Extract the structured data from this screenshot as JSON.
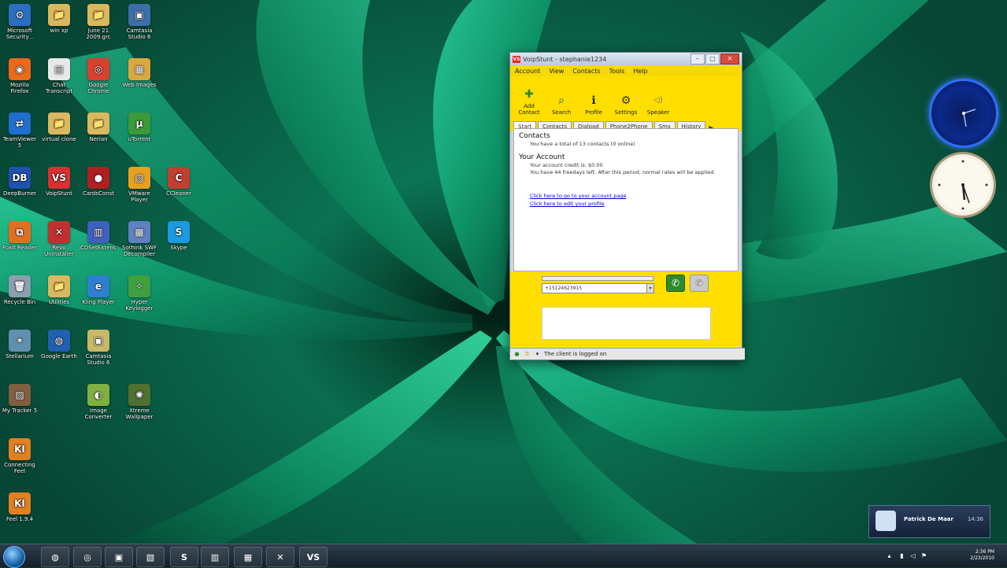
{
  "desktop": {
    "icons": [
      {
        "label": "Microsoft Security...",
        "glyph": "⚙",
        "color": "#2a6fc0"
      },
      {
        "label": "win xp",
        "glyph": "📁",
        "color": "#d9b860"
      },
      {
        "label": "June 21 2009.grc",
        "glyph": "📁",
        "color": "#d9b860"
      },
      {
        "label": "Camtasia Studio 6",
        "glyph": "▣",
        "color": "#3c6fa8"
      },
      {
        "label": "Mozilla Firefox",
        "glyph": "◉",
        "color": "#e86a1a"
      },
      {
        "label": "Chat Transcript",
        "glyph": "▤",
        "color": "#e8e8e8"
      },
      {
        "label": "Google Chrome",
        "glyph": "◎",
        "color": "#d9402e"
      },
      {
        "label": "Web Images",
        "glyph": "▦",
        "color": "#d9a840"
      },
      {
        "label": "TeamViewer 5",
        "glyph": "⇄",
        "color": "#1f6fcf"
      },
      {
        "label": "virtual clone",
        "glyph": "📁",
        "color": "#d9b860"
      },
      {
        "label": "Nerian",
        "glyph": "📁",
        "color": "#d9b860"
      },
      {
        "label": "uTorrent",
        "glyph": "µ",
        "color": "#3c9a3a"
      },
      {
        "label": "DeepBurner",
        "glyph": "DB",
        "color": "#2050b0"
      },
      {
        "label": "VoipStunt",
        "glyph": "VS",
        "color": "#d83030"
      },
      {
        "label": "CardsConst",
        "glyph": "●",
        "color": "#b02020"
      },
      {
        "label": "VMware Player",
        "glyph": "▧",
        "color": "#e8a020"
      },
      {
        "label": "CCleaner",
        "glyph": "C",
        "color": "#c04030"
      },
      {
        "label": "Foxit Reader",
        "glyph": "⧉",
        "color": "#e07020"
      },
      {
        "label": "Revo Uninstaller",
        "glyph": "✕",
        "color": "#c03030"
      },
      {
        "label": "CDSetExtensions",
        "glyph": "▥",
        "color": "#4060c0"
      },
      {
        "label": "Sothink SWF Decompiler",
        "glyph": "▩",
        "color": "#6080c0"
      },
      {
        "label": "Skype",
        "glyph": "S",
        "color": "#1a9ae0"
      },
      {
        "label": "Recycle Bin",
        "glyph": "🗑",
        "color": "#8aa0b0"
      },
      {
        "label": "Utilities",
        "glyph": "📁",
        "color": "#d9b860"
      },
      {
        "label": "Kling Player",
        "glyph": "e",
        "color": "#2f7fd0"
      },
      {
        "label": "Hyper Keylogger",
        "glyph": "✧",
        "color": "#40a040"
      },
      {
        "label": "Stellarium",
        "glyph": "✶",
        "color": "#6090b0"
      },
      {
        "label": "Google Earth",
        "glyph": "◍",
        "color": "#2060b0"
      },
      {
        "label": "Camtasia Studio 6",
        "glyph": "▣",
        "color": "#c8b868"
      },
      {
        "label": "My Tracker 5",
        "glyph": "▨",
        "color": "#806040"
      },
      {
        "label": "Image Converter",
        "glyph": "◐",
        "color": "#80b040"
      },
      {
        "label": "Xtreme Wallpaper",
        "glyph": "✺",
        "color": "#507030"
      },
      {
        "label": "Connecting Feel",
        "glyph": "KI",
        "color": "#e08020"
      },
      {
        "label": "Feel 1.9.4",
        "glyph": "KI",
        "color": "#e08020"
      }
    ]
  },
  "window": {
    "title": "VoipStunt - stephanie1234",
    "app_badge": "VS",
    "menu": [
      "Account",
      "View",
      "Contacts",
      "Tools",
      "Help"
    ],
    "toolbar": [
      {
        "label": "Add Contact",
        "glyph": "✚"
      },
      {
        "label": "Search",
        "glyph": "⌕"
      },
      {
        "label": "Profile",
        "glyph": "ℹ"
      },
      {
        "label": "Settings",
        "glyph": "⚙"
      },
      {
        "label": "Speaker",
        "glyph": "◁)"
      }
    ],
    "tabs": [
      "Start",
      "Contacts",
      "Dialpad",
      "Phone2Phone",
      "Sms",
      "History"
    ],
    "tab_more": "▶",
    "content": {
      "contacts_heading": "Contacts",
      "contacts_text": "You have a total of 13 contacts (0 online)",
      "account_heading": "Your Account",
      "account_credit": "Your account credit is: $0.00",
      "account_free": "You have 44 freedays left. After this period, normal rates will be applied.",
      "link_account": "Click here to go to your account page",
      "link_profile": "Click here to edit your profile"
    },
    "call": {
      "number_value": "+15124623915",
      "dropdown_arrow": "▾",
      "call_glyph": "✆",
      "end_glyph": "✆"
    },
    "status": "The client is logged on"
  },
  "notification": {
    "name": "Patrick De Maar",
    "time": "14:36"
  },
  "taskbar": {
    "buttons": [
      "◍",
      "◎",
      "▣",
      "▧",
      "S",
      "▥",
      "▦",
      "✕",
      "VS"
    ],
    "clock_time": "2:36 PM",
    "clock_date": "2/23/2010"
  }
}
